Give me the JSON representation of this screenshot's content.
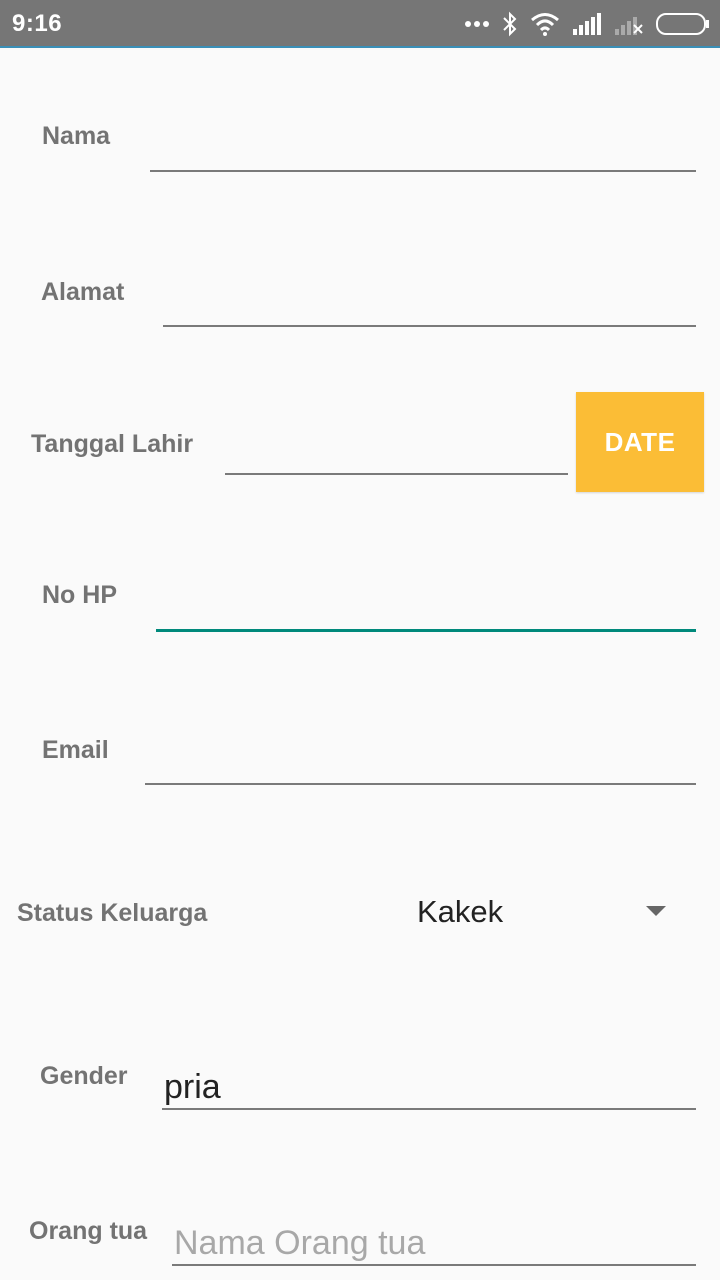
{
  "status_bar": {
    "time": "9:16",
    "icons": [
      "more-dots-icon",
      "bluetooth-icon",
      "wifi-icon",
      "signal-icon",
      "no-signal-icon",
      "battery-icon"
    ]
  },
  "form": {
    "nama": {
      "label": "Nama",
      "value": ""
    },
    "alamat": {
      "label": "Alamat",
      "value": ""
    },
    "tanggal_lahir": {
      "label": "Tanggal Lahir",
      "value": "",
      "button_label": "DATE"
    },
    "no_hp": {
      "label": "No HP",
      "value": ""
    },
    "email": {
      "label": "Email",
      "value": ""
    },
    "status_keluarga": {
      "label": "Status Keluarga",
      "selected": "Kakek"
    },
    "gender": {
      "label": "Gender",
      "value": "pria"
    },
    "orang_tua": {
      "label": "Orang tua",
      "value": "",
      "placeholder": "Nama Orang tua"
    }
  },
  "colors": {
    "date_button": "#fbbd36",
    "focused_underline": "#00897b",
    "status_bar": "#767676"
  }
}
